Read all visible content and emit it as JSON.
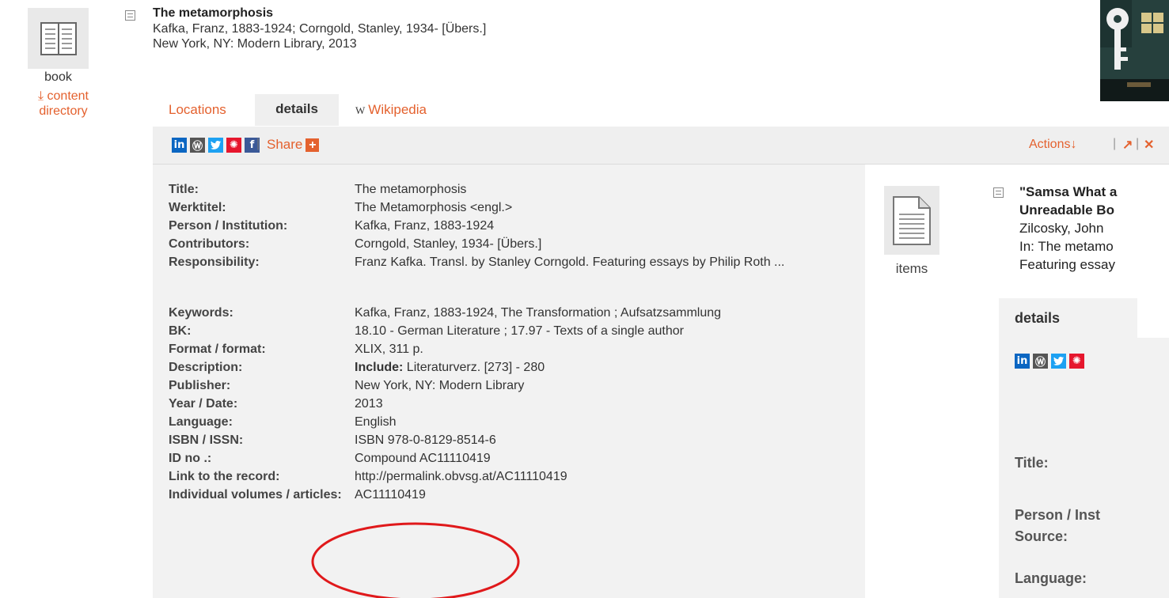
{
  "left": {
    "icon": "book-icon",
    "label": "book",
    "content_dir_line1": "content",
    "content_dir_line2": "directory"
  },
  "record": {
    "title": "The metamorphosis",
    "authors": "Kafka, Franz, 1883-1924; Corngold, Stanley, 1934- [Übers.]",
    "publication": "New York, NY: Modern Library, 2013"
  },
  "tabs": [
    {
      "label": "Locations"
    },
    {
      "label": "details"
    },
    {
      "label": "Wikipedia",
      "prefix": "W"
    }
  ],
  "share": {
    "separator": "|",
    "label": "Share",
    "plus": "+",
    "icons": [
      "linkedin-icon",
      "wordpress-icon",
      "twitter-icon",
      "weibo-icon",
      "facebook-icon"
    ]
  },
  "actions": {
    "label": "Actions",
    "arrow_down": "↓",
    "sep1": "|",
    "expand": "↗",
    "sep2": "|",
    "close": "✕"
  },
  "details": [
    {
      "label": "Title:",
      "value": "The metamorphosis",
      "link": false
    },
    {
      "label": "Werktitel:",
      "value": "The Metamorphosis <engl.>",
      "link": false
    },
    {
      "label": "Person / Institution:",
      "value": "Kafka, Franz, 1883-1924",
      "link": true
    },
    {
      "label": "Contributors:",
      "value": "Corngold, Stanley, 1934- [Übers.]",
      "link": true
    },
    {
      "label": "Responsibility:",
      "value": "Franz Kafka. Transl. by Stanley Corngold. Featuring essays by Philip Roth ...",
      "link": false
    },
    {
      "label": "Keywords:",
      "value": "Kafka, Franz, 1883-1924, The Transformation ; Aufsatzsammlung",
      "link": true
    },
    {
      "label": "BK:",
      "value": "18.10 - German Literature ; 17.97 - Texts of a single author",
      "link": true
    },
    {
      "label": "Format / format:",
      "value": "XLIX, 311 p.",
      "link": false
    },
    {
      "label": "Description:",
      "value_bold": "Include:",
      "value": "Literaturverz. [273] - 280",
      "link": false
    },
    {
      "label": "Publisher:",
      "value": "New York, NY: Modern Library",
      "link": false
    },
    {
      "label": "Year / Date:",
      "value": "2013",
      "link": false
    },
    {
      "label": "Language:",
      "value": "English",
      "link": false
    },
    {
      "label": "ISBN / ISSN:",
      "value": "ISBN 978-0-8129-8514-6",
      "link": false
    },
    {
      "label": "ID no .:",
      "value": "Compound AC11110419",
      "link": false
    },
    {
      "label": "Link to the record:",
      "value": "http://permalink.obvsg.at/AC11110419",
      "link": false
    },
    {
      "label": "Individual volumes / articles:",
      "value": "AC11110419",
      "link": true
    }
  ],
  "related": {
    "items_label": "items",
    "items_icon": "document-icon",
    "title_line1": "\"Samsa What a",
    "title_line2": "Unreadable Bo",
    "author": "Zilcosky, John",
    "in_line": "In: The metamo",
    "featuring_line": "Featuring essay",
    "details_tab": "details",
    "labels": [
      "Title:",
      "Person / Inst",
      "Source:",
      "Language:"
    ]
  },
  "colors": {
    "accent": "#e4612e",
    "annotation_circle": "#e0191b"
  }
}
